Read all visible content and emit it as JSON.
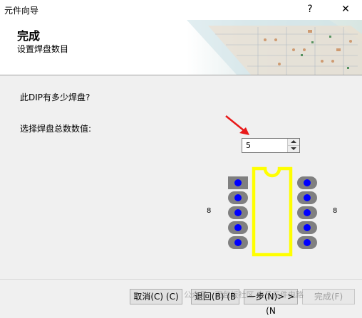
{
  "window": {
    "title": "元件向导",
    "help_glyph": "?",
    "close_glyph": "✕"
  },
  "header": {
    "title": "完成",
    "subtitle": "设置焊盘数目"
  },
  "content": {
    "question": "此DIP有多少焊盘?",
    "spin_label": "选择焊盘总数数值:",
    "pad_count_value": "5",
    "left_pin_label": "8",
    "right_pin_label": "8"
  },
  "footer": {
    "cancel": "取消(C) (C)",
    "back": "退回(B) (B",
    "next": "一步(N)> > (N",
    "finish": "完成(F)",
    "watermark": "公众号 · 面包板社区 电子元件电路"
  },
  "colors": {
    "pad_gray": "#808080",
    "pad_blue": "#0000ff",
    "outline_yellow": "#ffff00",
    "arrow_red": "#e81919"
  }
}
